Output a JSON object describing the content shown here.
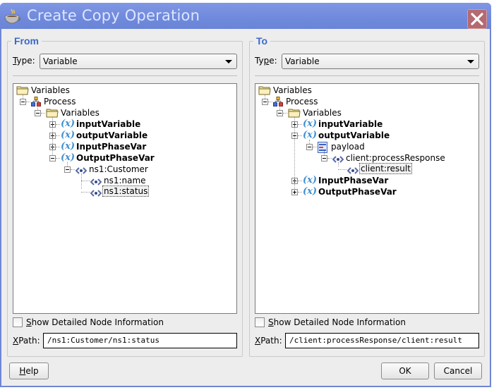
{
  "window": {
    "title": "Create Copy Operation",
    "close_label": "Close"
  },
  "from": {
    "legend": "From",
    "type_label_prefix": "",
    "type_label_mnemonic": "T",
    "type_label_rest": "ype:",
    "type_value": "Variable",
    "tree": [
      {
        "label": "Variables",
        "icon": "folder-icon",
        "level": 0,
        "bold": false
      },
      {
        "label": "Process",
        "icon": "process-icon",
        "level": 1,
        "expander": "minus",
        "bold": false
      },
      {
        "label": "Variables",
        "icon": "folder-icon",
        "level": 2,
        "expander": "minus",
        "bold": false
      },
      {
        "label": "inputVariable",
        "icon": "variable-icon",
        "level": 3,
        "expander": "plus",
        "bold": true
      },
      {
        "label": "outputVariable",
        "icon": "variable-icon",
        "level": 3,
        "expander": "plus",
        "bold": true
      },
      {
        "label": "InputPhaseVar",
        "icon": "variable-icon",
        "level": 3,
        "expander": "plus",
        "bold": true
      },
      {
        "label": "OutputPhaseVar",
        "icon": "variable-icon",
        "level": 3,
        "expander": "minus",
        "bold": true
      },
      {
        "label": "ns1:Customer",
        "icon": "element-icon",
        "level": 4,
        "expander": "minus",
        "bold": false
      },
      {
        "label": "ns1:name",
        "icon": "element-icon",
        "level": 5,
        "bold": false
      },
      {
        "label": "ns1:status",
        "icon": "element-icon",
        "level": 5,
        "bold": false,
        "selected": true
      }
    ],
    "show_detail_label_mnemonic": "S",
    "show_detail_label_rest": "how Detailed Node Information",
    "show_detail_checked": false,
    "xpath_label_mnemonic": "X",
    "xpath_label_rest": "Path:",
    "xpath_value": "/ns1:Customer/ns1:status"
  },
  "to": {
    "legend": "To",
    "type_label_prefix": "Ty",
    "type_label_mnemonic": "p",
    "type_label_rest": "e:",
    "type_value": "Variable",
    "tree": [
      {
        "label": "Variables",
        "icon": "folder-icon",
        "level": 0,
        "bold": false
      },
      {
        "label": "Process",
        "icon": "process-icon",
        "level": 1,
        "expander": "minus",
        "bold": false
      },
      {
        "label": "Variables",
        "icon": "folder-icon",
        "level": 2,
        "expander": "minus",
        "bold": false
      },
      {
        "label": "inputVariable",
        "icon": "variable-icon",
        "level": 3,
        "expander": "plus",
        "bold": true
      },
      {
        "label": "outputVariable",
        "icon": "variable-icon",
        "level": 3,
        "expander": "minus",
        "bold": true
      },
      {
        "label": "payload",
        "icon": "message-part-icon",
        "level": 4,
        "expander": "minus",
        "bold": false
      },
      {
        "label": "client:processResponse",
        "icon": "element-icon",
        "level": 5,
        "expander": "minus",
        "bold": false
      },
      {
        "label": "client:result",
        "icon": "element-icon",
        "level": 6,
        "bold": false,
        "selected": true
      },
      {
        "label": "InputPhaseVar",
        "icon": "variable-icon",
        "level": 3,
        "expander": "plus",
        "bold": true
      },
      {
        "label": "OutputPhaseVar",
        "icon": "variable-icon",
        "level": 3,
        "expander": "plus",
        "bold": true
      }
    ],
    "show_detail_label_mnemonic": "S",
    "show_detail_label_rest": "how Detailed Node Information",
    "show_detail_checked": false,
    "xpath_label_mnemonic": "X",
    "xpath_label_rest": "Path:",
    "xpath_value": "/client:processResponse/client:result"
  },
  "buttons": {
    "help_mnemonic": "H",
    "help_rest": "elp",
    "ok": "OK",
    "cancel": "Cancel"
  },
  "colors": {
    "titlebar": "#7088dc",
    "legend": "#3b68c9",
    "close": "#b46a72",
    "variable_icon": "#3f8fd0"
  }
}
